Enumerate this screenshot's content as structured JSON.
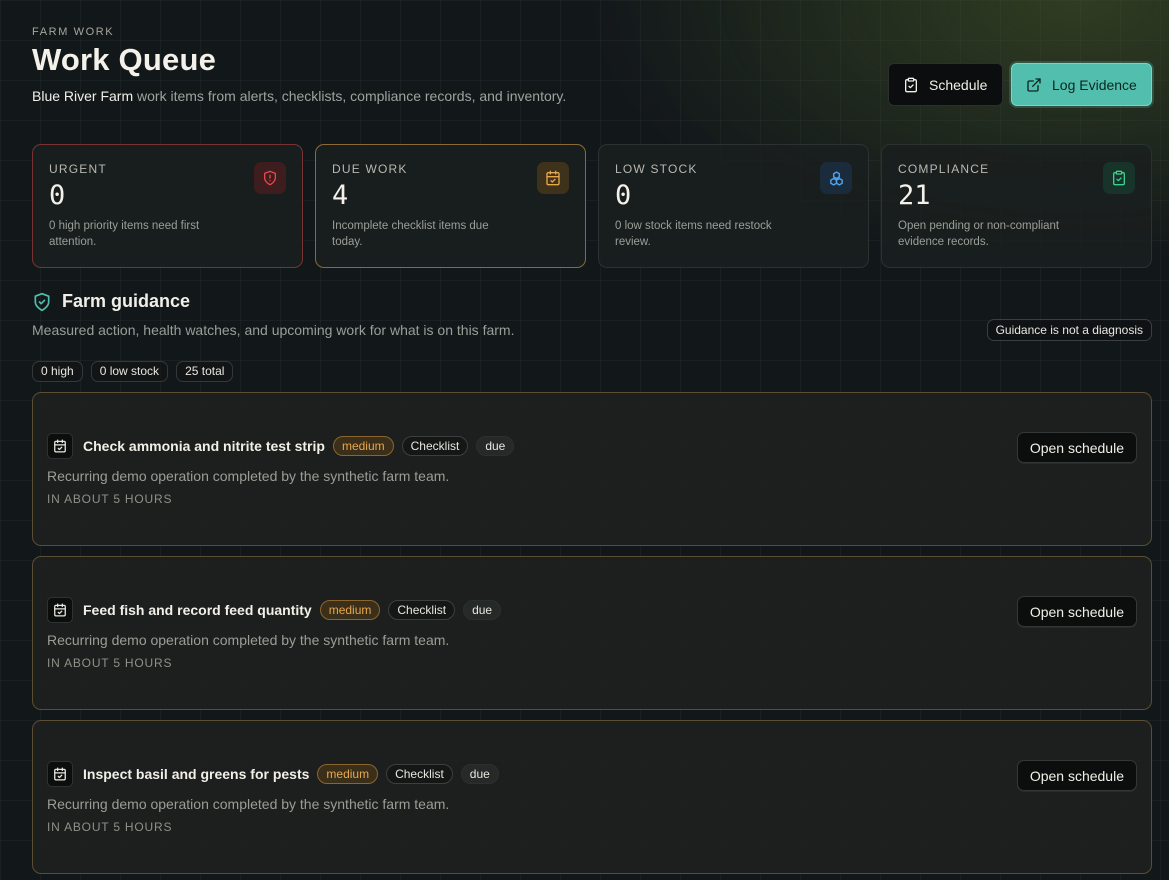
{
  "header": {
    "eyebrow": "FARM WORK",
    "title": "Work Queue",
    "farm_name": "Blue River Farm",
    "subtitle_rest": " work items from alerts, checklists, compliance records, and inventory.",
    "schedule_label": "Schedule",
    "log_evidence_label": "Log Evidence"
  },
  "stats": [
    {
      "label": "URGENT",
      "value": "0",
      "desc": "0 high priority items need first attention.",
      "icon": "shield-alert-icon",
      "color": "#e5484d"
    },
    {
      "label": "DUE WORK",
      "value": "4",
      "desc": "Incomplete checklist items due today.",
      "icon": "calendar-check-icon",
      "color": "#e6a84e"
    },
    {
      "label": "LOW STOCK",
      "value": "0",
      "desc": "0 low stock items need restock review.",
      "icon": "boxes-icon",
      "color": "#4ea3f0"
    },
    {
      "label": "COMPLIANCE",
      "value": "21",
      "desc": "Open pending or non-compliant evidence records.",
      "icon": "clipboard-check-icon",
      "color": "#3ecf8e"
    }
  ],
  "guidance": {
    "title": "Farm guidance",
    "subtitle": "Measured action, health watches, and upcoming work for what is on this farm.",
    "note": "Guidance is not a diagnosis",
    "chips": [
      "0 high",
      "0 low stock",
      "25 total"
    ]
  },
  "items": [
    {
      "title": "Check ammonia and nitrite test strip",
      "priority": "medium",
      "category": "Checklist",
      "status": "due",
      "desc": "Recurring demo operation completed by the synthetic farm team.",
      "time": "IN ABOUT 5 HOURS",
      "action": "Open schedule"
    },
    {
      "title": "Feed fish and record feed quantity",
      "priority": "medium",
      "category": "Checklist",
      "status": "due",
      "desc": "Recurring demo operation completed by the synthetic farm team.",
      "time": "IN ABOUT 5 HOURS",
      "action": "Open schedule"
    },
    {
      "title": "Inspect basil and greens for pests",
      "priority": "medium",
      "category": "Checklist",
      "status": "due",
      "desc": "Recurring demo operation completed by the synthetic farm team.",
      "time": "IN ABOUT 5 HOURS",
      "action": "Open schedule"
    }
  ],
  "colors": {
    "accent": "#52bfae",
    "medium": "#e6a84e"
  }
}
